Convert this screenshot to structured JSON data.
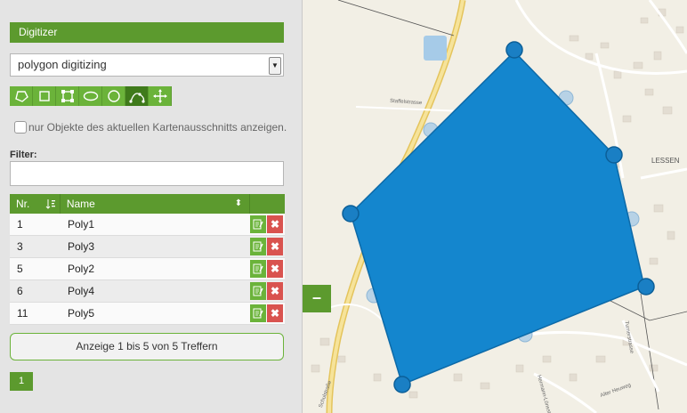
{
  "panel": {
    "title": "Digitizer",
    "mode_select": {
      "value": "polygon digitizing"
    },
    "tools": [
      {
        "icon": "polygon-icon",
        "active": false
      },
      {
        "icon": "rectangle-icon",
        "active": false
      },
      {
        "icon": "box-select-icon",
        "active": false
      },
      {
        "icon": "ellipse-icon",
        "active": false
      },
      {
        "icon": "circle-icon",
        "active": false
      },
      {
        "icon": "edit-vertices-icon",
        "active": true
      },
      {
        "icon": "move-icon",
        "active": false
      }
    ],
    "visible_only_label": "nur Objekte des aktuellen Kartenausschnitts anzeigen.",
    "filter_label": "Filter:",
    "filter_value": "",
    "table": {
      "headers": {
        "nr": "Nr.",
        "name": "Name"
      },
      "rows": [
        {
          "nr": "1",
          "name": "Poly1"
        },
        {
          "nr": "3",
          "name": "Poly3"
        },
        {
          "nr": "5",
          "name": "Poly2"
        },
        {
          "nr": "6",
          "name": "Poly4"
        },
        {
          "nr": "11",
          "name": "Poly5"
        }
      ]
    },
    "summary": "Anzeige 1 bis 5 von 5 Treffern",
    "page": "1",
    "collapse_label": "–"
  },
  "map": {
    "labels": [
      "Staffelstrasse",
      "LESSEN",
      "Turnerstrasse",
      "Hermann-Lönsstraße",
      "Alter Heuweg",
      "Schulstraße"
    ],
    "polygon_color": "#1486ce",
    "vertex_color": "#1a7fc4"
  },
  "colors": {
    "accent": "#5c9a2e",
    "button_green": "#6bb33a",
    "delete_red": "#d9534f"
  }
}
